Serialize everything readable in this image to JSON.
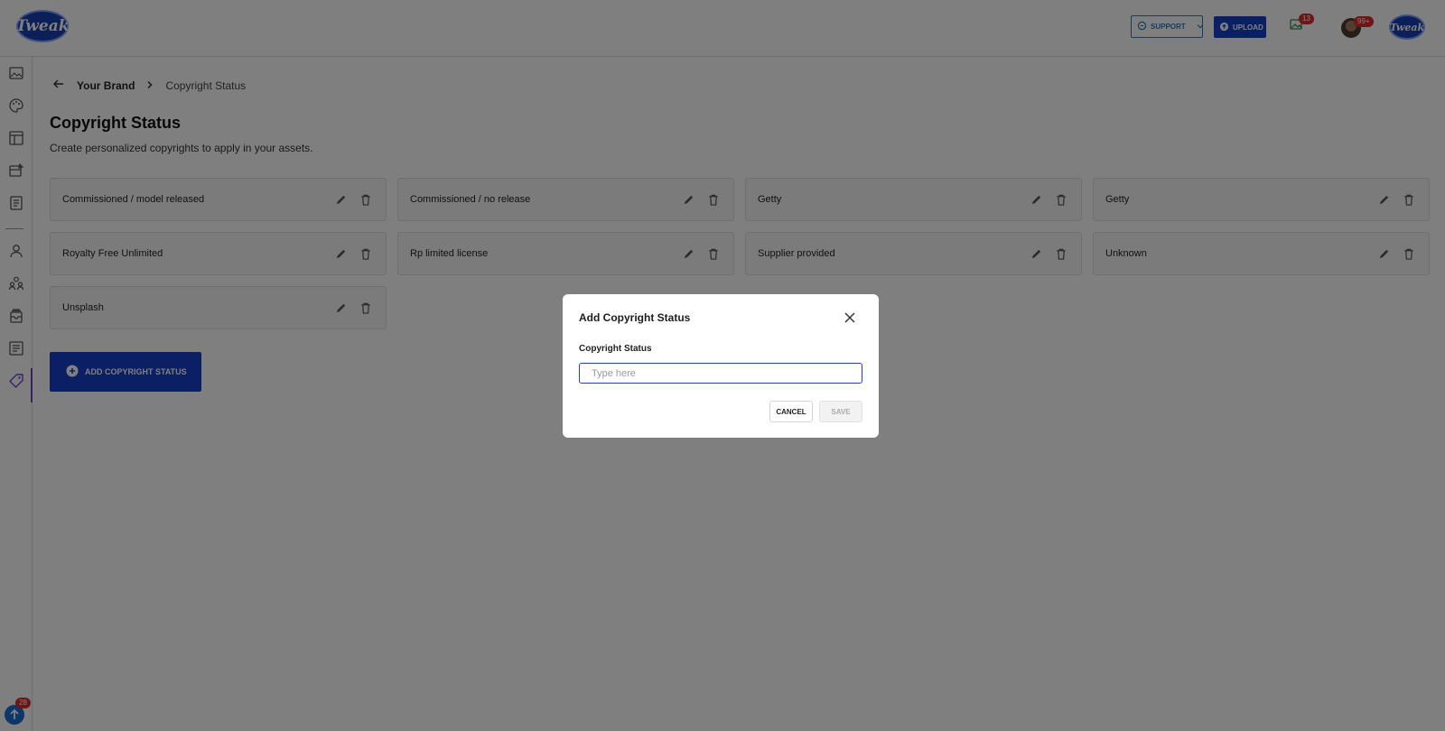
{
  "header": {
    "logo_text": "Tweak",
    "support_label": "SUPPORT",
    "upload_label": "UPLOAD",
    "notifications_count": "13",
    "profile_badge": "99+",
    "brand_logo_text": "Tweak"
  },
  "sidebar": {
    "items": [
      {
        "icon": "image-icon"
      },
      {
        "icon": "palette-icon"
      },
      {
        "icon": "layout-icon"
      },
      {
        "icon": "gallery-edit-icon"
      },
      {
        "icon": "document-icon"
      },
      {
        "icon": "user-icon"
      },
      {
        "icon": "team-icon"
      },
      {
        "icon": "inbox-icon"
      },
      {
        "icon": "notes-icon"
      },
      {
        "icon": "tag-icon"
      }
    ],
    "help_badge": "28"
  },
  "breadcrumb": {
    "parent": "Your Brand",
    "current": "Copyright Status"
  },
  "page": {
    "title": "Copyright Status",
    "subtitle": "Create personalized copyrights to apply in your assets."
  },
  "statuses": [
    "Commissioned / model released",
    "Commissioned / no release",
    "Getty",
    "Getty",
    "Royalty Free Unlimited",
    "Rp limited license",
    "Supplier provided",
    "Unknown",
    "Unsplash"
  ],
  "add_button_label": "ADD COPYRIGHT STATUS",
  "modal": {
    "title": "Add Copyright Status",
    "field_label": "Copyright Status",
    "input_placeholder": "Type here",
    "input_value": "",
    "cancel_label": "CANCEL",
    "save_label": "SAVE"
  },
  "colors": {
    "primary": "#1741c8",
    "badge": "#d92d2d",
    "active_accent": "#7a3fc7"
  }
}
